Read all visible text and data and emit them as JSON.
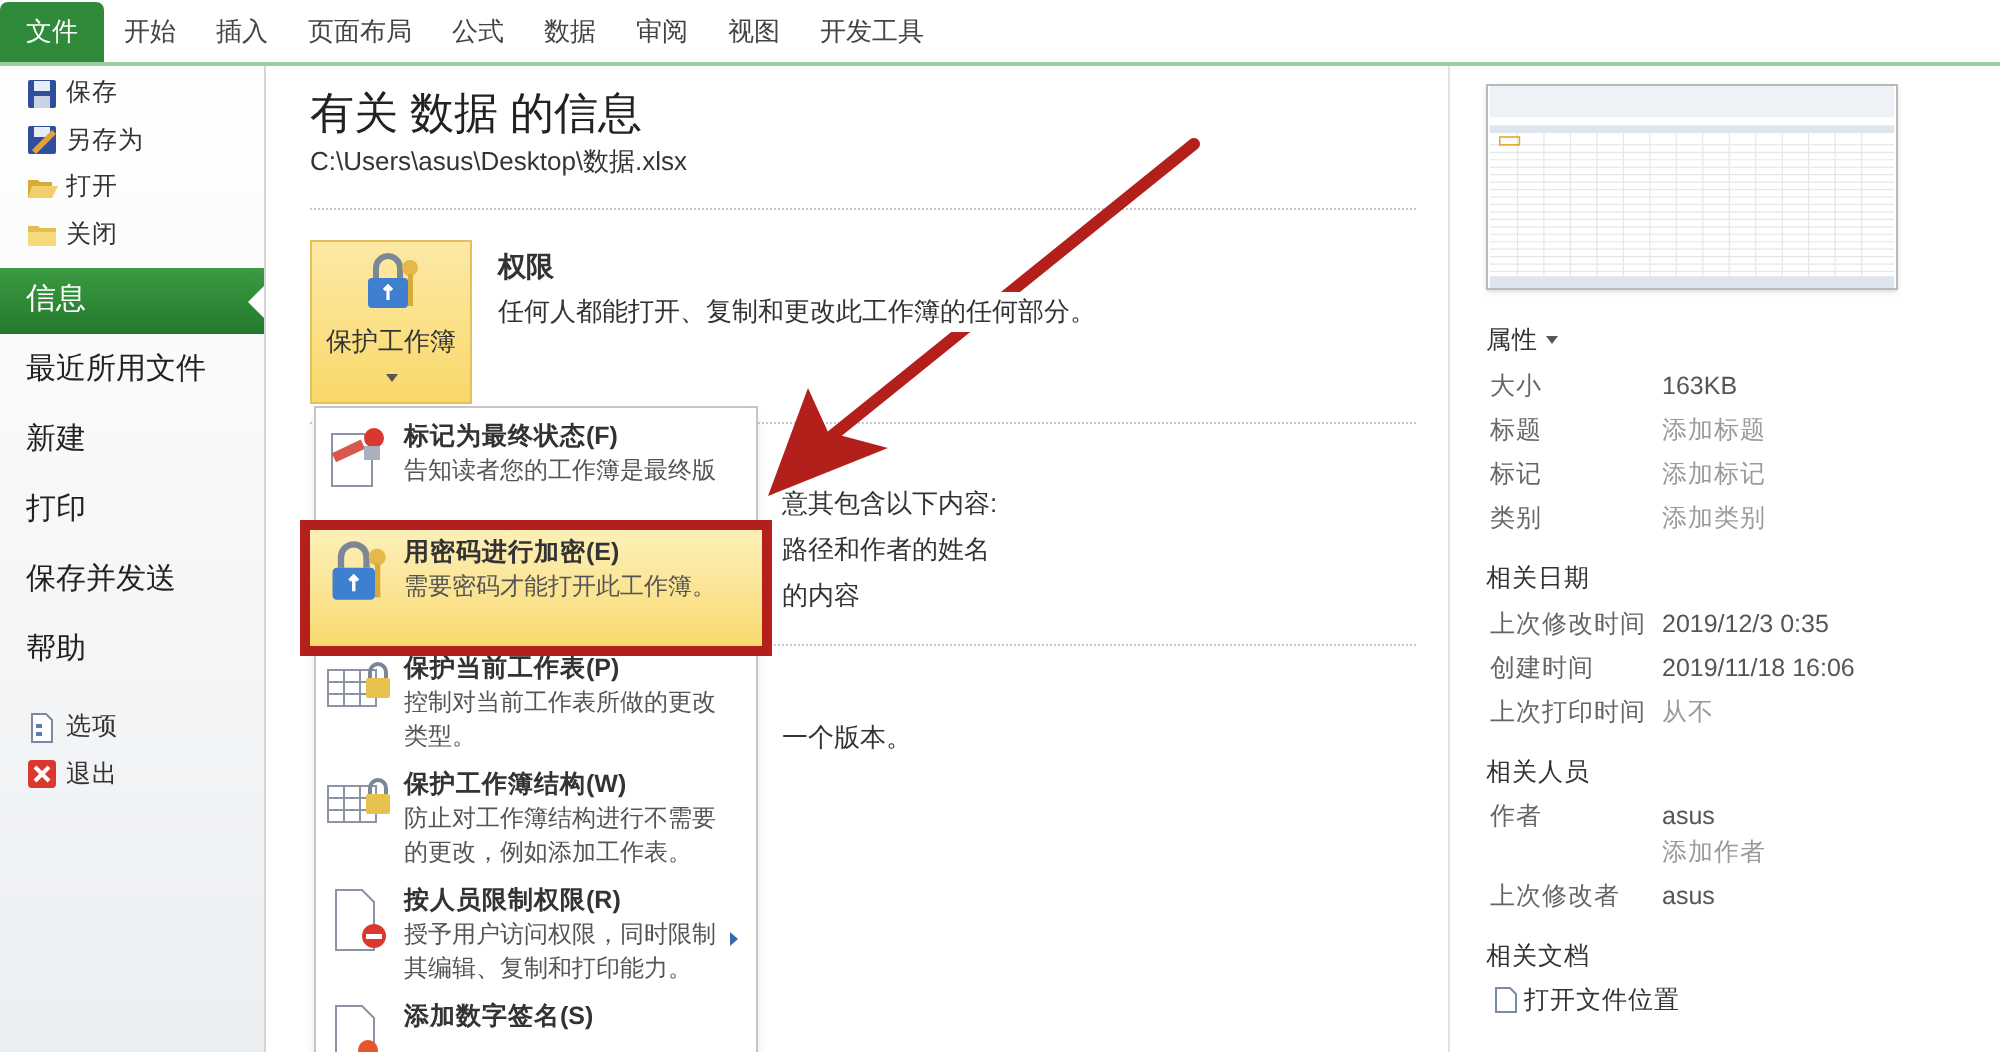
{
  "tabs": [
    {
      "label": "文件",
      "selected": true
    },
    {
      "label": "开始",
      "selected": false
    },
    {
      "label": "插入",
      "selected": false
    },
    {
      "label": "页面布局",
      "selected": false
    },
    {
      "label": "公式",
      "selected": false
    },
    {
      "label": "数据",
      "selected": false
    },
    {
      "label": "审阅",
      "selected": false
    },
    {
      "label": "视图",
      "selected": false
    },
    {
      "label": "开发工具",
      "selected": false
    }
  ],
  "sidebar": {
    "items": [
      {
        "label": "保存",
        "kind": "command",
        "selected": false
      },
      {
        "label": "另存为",
        "kind": "command",
        "selected": false
      },
      {
        "label": "打开",
        "kind": "command",
        "selected": false
      },
      {
        "label": "关闭",
        "kind": "command",
        "selected": false
      },
      {
        "label": "信息",
        "kind": "page",
        "selected": true
      },
      {
        "label": "最近所用文件",
        "kind": "page",
        "selected": false
      },
      {
        "label": "新建",
        "kind": "page",
        "selected": false
      },
      {
        "label": "打印",
        "kind": "page",
        "selected": false
      },
      {
        "label": "保存并发送",
        "kind": "page",
        "selected": false
      },
      {
        "label": "帮助",
        "kind": "page",
        "selected": false
      },
      {
        "label": "选项",
        "kind": "command",
        "selected": false
      },
      {
        "label": "退出",
        "kind": "command",
        "selected": false
      }
    ]
  },
  "info": {
    "title": "有关 数据 的信息",
    "path": "C:\\Users\\asus\\Desktop\\数据.xlsx",
    "permissions": {
      "button_label": "保护工作簿",
      "heading": "权限",
      "description": "任何人都能打开、复制和更改此工作簿的任何部分。"
    },
    "inspect_lines": [
      "意其包含以下内容:",
      "路径和作者的姓名",
      "的内容"
    ],
    "versions_line": "一个版本。"
  },
  "protect_menu": {
    "items": [
      {
        "title": "标记为最终状态(F)",
        "description": [
          "告知读者您的工作簿是最终版"
        ],
        "selected": false,
        "has_submenu": false
      },
      {
        "title": "用密码进行加密(E)",
        "description": [
          "需要密码才能打开此工作簿。"
        ],
        "selected": true,
        "has_submenu": false
      },
      {
        "title": "保护当前工作表(P)",
        "description": [
          "控制对当前工作表所做的更改",
          "类型。"
        ],
        "selected": false,
        "has_submenu": false
      },
      {
        "title": "保护工作簿结构(W)",
        "description": [
          "防止对工作簿结构进行不需要",
          "的更改，例如添加工作表。"
        ],
        "selected": false,
        "has_submenu": false
      },
      {
        "title": "按人员限制权限(R)",
        "description": [
          "授予用户访问权限，同时限制",
          "其编辑、复制和打印能力。"
        ],
        "selected": false,
        "has_submenu": true
      },
      {
        "title": "添加数字签名(S)",
        "selected": false,
        "has_submenu": false
      }
    ]
  },
  "properties": {
    "sections": [
      {
        "heading": "属性",
        "has_dropdown": true,
        "rows": [
          {
            "label": "大小",
            "values": [
              {
                "text": "163KB",
                "kind": "value"
              }
            ]
          },
          {
            "label": "标题",
            "values": [
              {
                "text": "添加标题",
                "kind": "placeholder"
              }
            ]
          },
          {
            "label": "标记",
            "values": [
              {
                "text": "添加标记",
                "kind": "placeholder"
              }
            ]
          },
          {
            "label": "类别",
            "values": [
              {
                "text": "添加类别",
                "kind": "placeholder"
              }
            ]
          }
        ]
      },
      {
        "heading": "相关日期",
        "has_dropdown": false,
        "rows": [
          {
            "label": "上次修改时间",
            "values": [
              {
                "text": "2019/12/3 0:35",
                "kind": "value"
              }
            ]
          },
          {
            "label": "创建时间",
            "values": [
              {
                "text": "2019/11/18 16:06",
                "kind": "value"
              }
            ]
          },
          {
            "label": "上次打印时间",
            "values": [
              {
                "text": "从不",
                "kind": "placeholder"
              }
            ]
          }
        ]
      },
      {
        "heading": "相关人员",
        "has_dropdown": false,
        "rows": [
          {
            "label": "作者",
            "values": [
              {
                "text": "asus",
                "kind": "value"
              },
              {
                "text": "添加作者",
                "kind": "placeholder"
              }
            ]
          },
          {
            "label": "上次修改者",
            "values": [
              {
                "text": "asus",
                "kind": "value"
              }
            ]
          }
        ]
      },
      {
        "heading": "相关文档",
        "has_dropdown": false,
        "links": [
          "打开文件位置"
        ]
      }
    ]
  }
}
